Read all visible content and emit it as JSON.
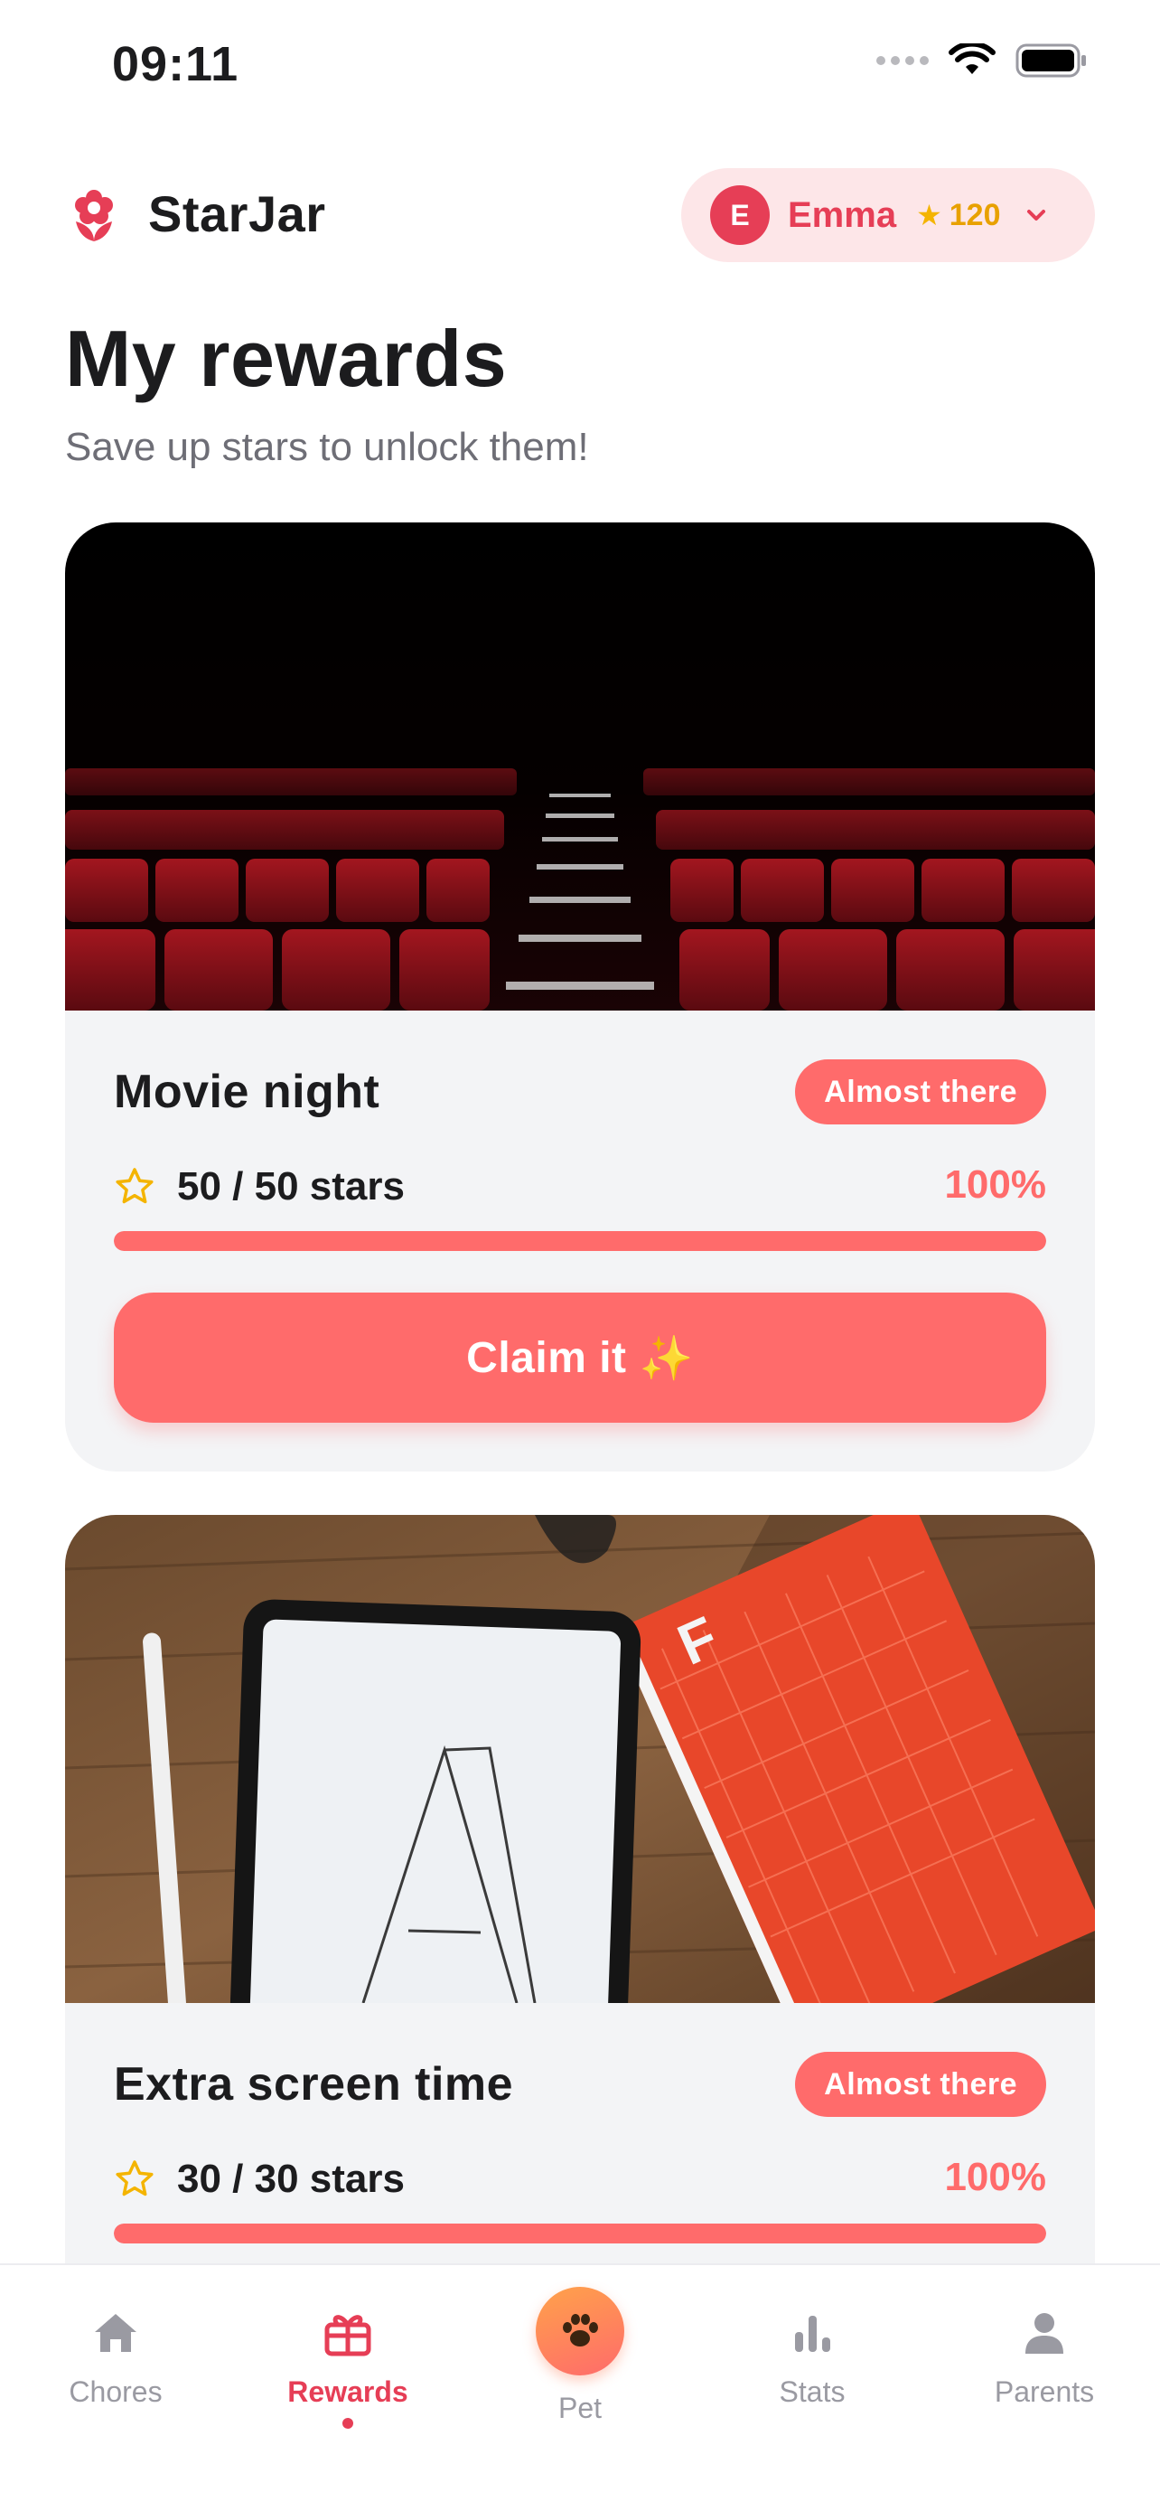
{
  "status_bar": {
    "time": "09:11"
  },
  "header": {
    "app_name": "StarJar",
    "profile": {
      "initial": "E",
      "name": "Emma",
      "stars": "120"
    }
  },
  "page": {
    "title": "My rewards",
    "subtitle": "Save up stars to unlock them!"
  },
  "rewards": [
    {
      "title": "Movie night",
      "badge": "Almost there",
      "stars_text": "50 / 50 stars",
      "percent_text": "100%",
      "progress": 1.0,
      "button_label": "Claim it",
      "button_emoji": "✨",
      "image_subject": "cinema-seats"
    },
    {
      "title": "Extra screen time",
      "badge": "Almost there",
      "stars_text": "30 / 30 stars",
      "percent_text": "100%",
      "progress": 1.0,
      "image_subject": "tablet-and-book"
    }
  ],
  "tabs": [
    {
      "label": "Chores",
      "icon": "home-icon",
      "active": false
    },
    {
      "label": "Rewards",
      "icon": "gift-icon",
      "active": true
    },
    {
      "label": "Pet",
      "icon": "paw-icon",
      "active": false
    },
    {
      "label": "Stats",
      "icon": "bar-chart-icon",
      "active": false
    },
    {
      "label": "Parents",
      "icon": "person-icon",
      "active": false
    }
  ],
  "colors": {
    "accent": "#ff6b6b",
    "brand": "#e63e56",
    "star": "#f4b400",
    "card_bg": "#f3f4f6",
    "inactive": "#9a9aa2"
  }
}
